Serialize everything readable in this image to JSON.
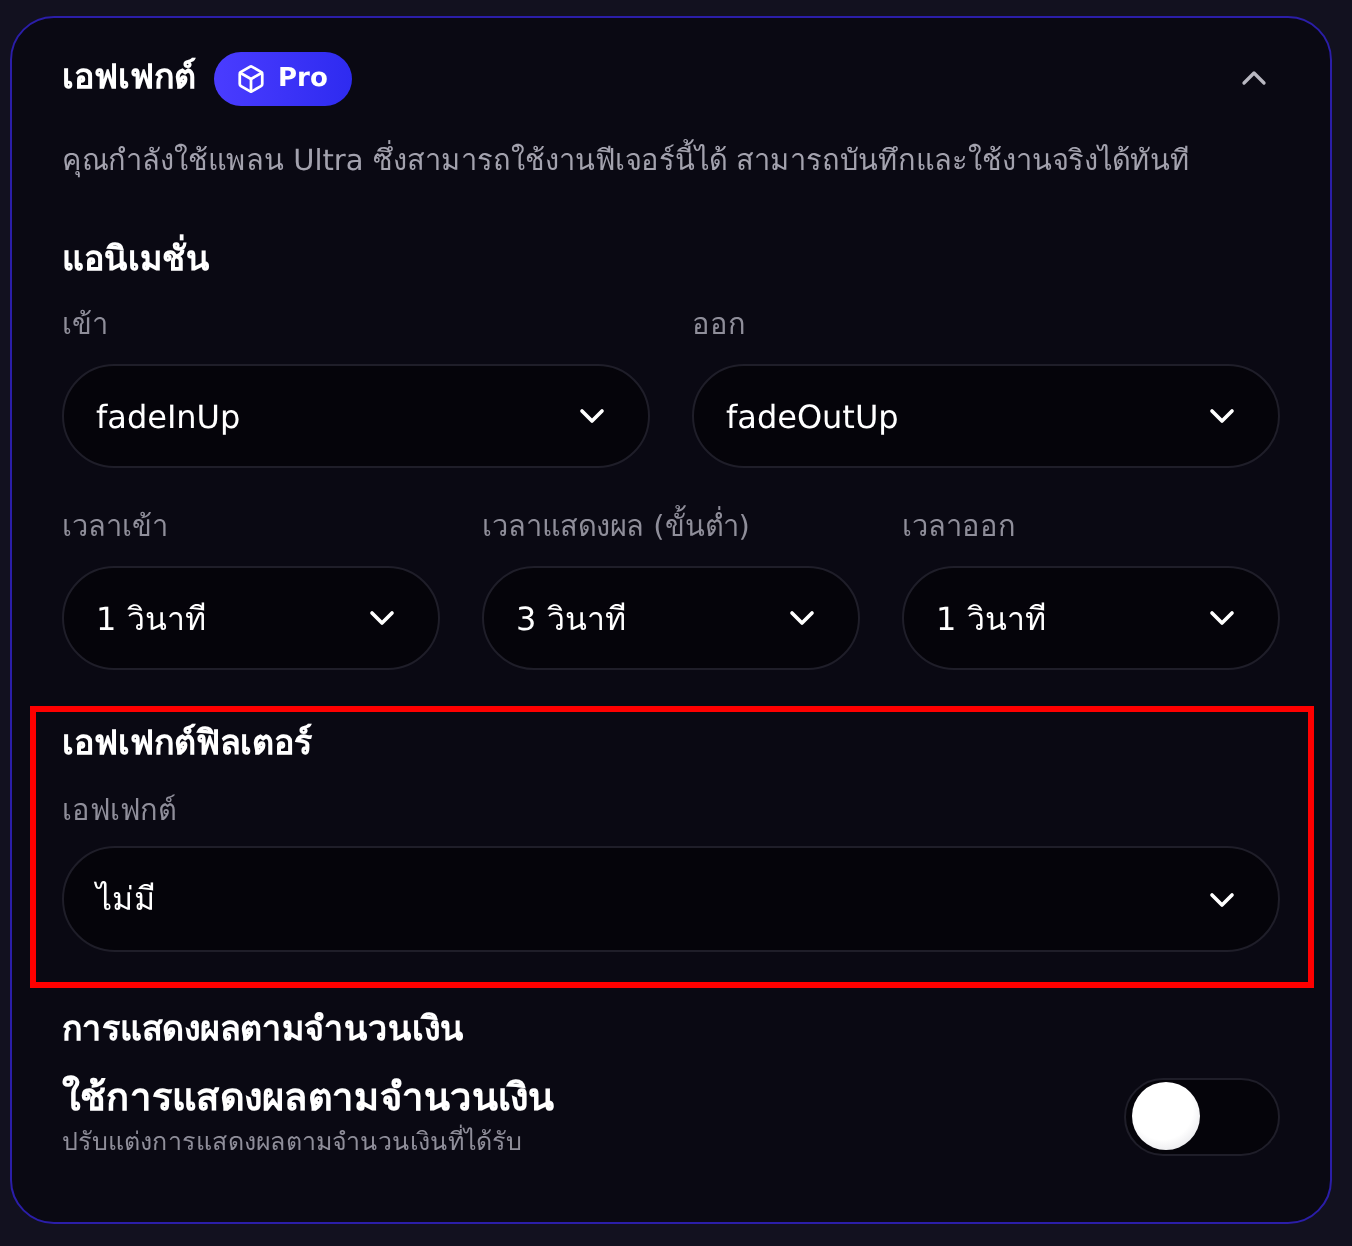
{
  "header": {
    "title": "เอฟเฟกต์",
    "badge": "Pro",
    "expanded": true
  },
  "description": "คุณกำลังใช้แพลน Ultra ซึ่งสามารถใช้งานฟีเจอร์นี้ได้ สามารถบันทึกและใช้งานจริงได้ทันที",
  "animation": {
    "title": "แอนิเมชั่น",
    "rows": [
      {
        "fields": [
          {
            "label": "เข้า",
            "value": "fadeInUp"
          },
          {
            "label": "ออก",
            "value": "fadeOutUp"
          }
        ]
      },
      {
        "fields": [
          {
            "label": "เวลาเข้า",
            "value": "1 วินาที"
          },
          {
            "label": "เวลาแสดงผล (ขั้นต่ำ)",
            "value": "3 วินาที"
          },
          {
            "label": "เวลาออก",
            "value": "1 วินาที"
          }
        ]
      }
    ]
  },
  "filter": {
    "title": "เอฟเฟกต์ฟิลเตอร์",
    "highlighted": true,
    "field": {
      "label": "เอฟเฟกต์",
      "value": "ไม่มี"
    }
  },
  "amount_display": {
    "title": "การแสดงผลตามจำนวนเงิน",
    "setting": {
      "label": "ใช้การแสดงผลตามจำนวนเงิน",
      "description": "ปรับแต่งการแสดงผลตามจำนวนเงินที่ได้รับ",
      "on": false
    }
  }
}
